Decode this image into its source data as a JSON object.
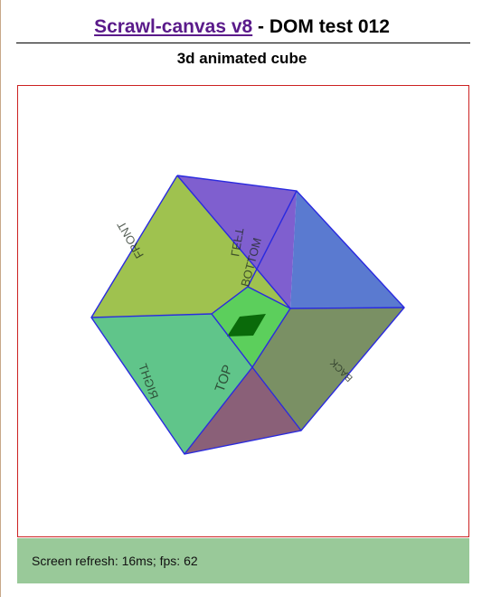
{
  "header": {
    "link_text": "Scrawl-canvas v8",
    "title_suffix": " - DOM test 012",
    "subtitle": "3d animated cube"
  },
  "cube": {
    "labels": {
      "front": "FRONT",
      "left": "LEFT",
      "bottom": "BOTTOM",
      "top": "TOP",
      "back": "BACK",
      "right": "RIGHT"
    },
    "colors": {
      "edge": "#2a2adf",
      "border": "#cc2222",
      "face_front": "#9fc24f",
      "face_left": "#7f5fcf",
      "face_right_upper": "#5a7ad0",
      "face_right_lower": "#7a9064",
      "face_bottom_lower": "#8a6078",
      "face_left_lower": "#60c58a",
      "center": "#5ccf5c",
      "center_marker": "#0a6a0a"
    }
  },
  "status": {
    "text": "Screen refresh: 16ms; fps: 62"
  }
}
